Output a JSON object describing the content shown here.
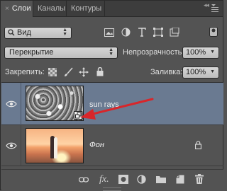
{
  "tabs": [
    {
      "label": "Слои",
      "close": "×"
    },
    {
      "label": "Каналы"
    },
    {
      "label": "Контуры"
    }
  ],
  "header": {
    "collapse_glyph": "◂◂"
  },
  "filter": {
    "kind_label": "Вид"
  },
  "blend": {
    "mode": "Перекрытие",
    "opacity_label": "Непрозрачность:",
    "opacity_value": "100%"
  },
  "lock": {
    "label": "Закрепить:",
    "fill_label": "Заливка:",
    "fill_value": "100%"
  },
  "layers": [
    {
      "name": "sun rays",
      "selected": true,
      "visible": true,
      "locked": false
    },
    {
      "name": "Фон",
      "selected": false,
      "visible": true,
      "locked": true
    }
  ],
  "bottom": {
    "fx_label": "fx."
  },
  "colors": {
    "selection": "#6a7a91",
    "arrow": "#d8262a",
    "panel": "#535353"
  }
}
